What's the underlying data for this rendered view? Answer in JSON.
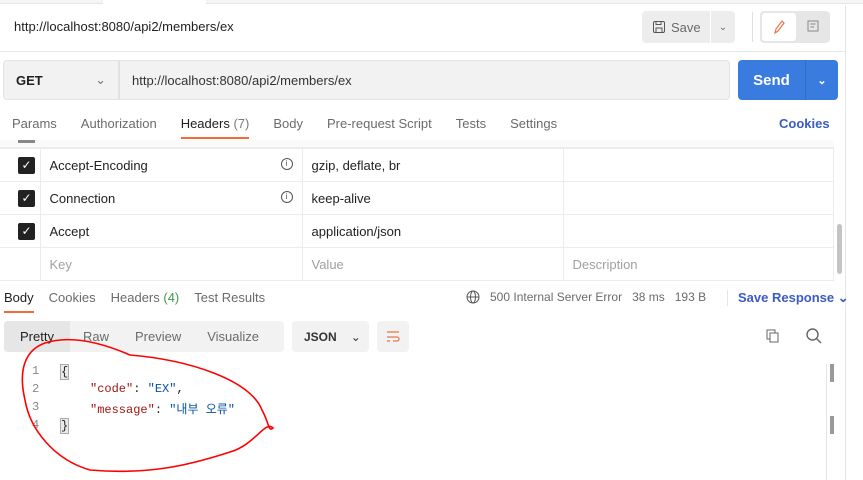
{
  "title": "http://localhost:8080/api2/members/ex",
  "toolbar": {
    "save_label": "Save"
  },
  "request": {
    "method": "GET",
    "url": "http://localhost:8080/api2/members/ex",
    "send_label": "Send"
  },
  "request_tabs": [
    {
      "label": "Params"
    },
    {
      "label": "Authorization"
    },
    {
      "label": "Headers",
      "count": "(7)"
    },
    {
      "label": "Body"
    },
    {
      "label": "Pre-request Script"
    },
    {
      "label": "Tests"
    },
    {
      "label": "Settings"
    }
  ],
  "cookies_label": "Cookies",
  "headers": [
    {
      "key": "Accept-Encoding",
      "value": "gzip, deflate, br",
      "checked": true
    },
    {
      "key": "Connection",
      "value": "keep-alive",
      "checked": true
    },
    {
      "key": "Accept",
      "value": "application/json",
      "checked": true
    }
  ],
  "header_placeholders": {
    "key": "Key",
    "value": "Value",
    "description": "Description"
  },
  "response_tabs": [
    {
      "label": "Body"
    },
    {
      "label": "Cookies"
    },
    {
      "label": "Headers",
      "count": "(4)"
    },
    {
      "label": "Test Results"
    }
  ],
  "response_status": {
    "status": "500 Internal Server Error",
    "time": "38 ms",
    "size": "193 B",
    "save_label": "Save Response"
  },
  "body_formats": [
    "Pretty",
    "Raw",
    "Preview",
    "Visualize"
  ],
  "body_language": "JSON",
  "code_lines": [
    {
      "n": "1",
      "text": "{"
    },
    {
      "n": "2",
      "key": "\"code\"",
      "sep": ": ",
      "val": "\"EX\"",
      "end": ","
    },
    {
      "n": "3",
      "key": "\"message\"",
      "sep": ": ",
      "val": "\"내부 오류\"",
      "end": ""
    },
    {
      "n": "4",
      "text": "}"
    }
  ],
  "colors": {
    "accent": "#3a7be0",
    "tab_underline": "#f26b3a",
    "annotation": "#ff0000"
  }
}
